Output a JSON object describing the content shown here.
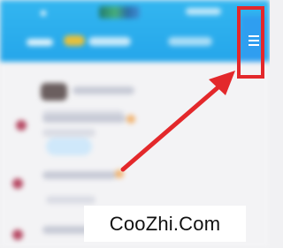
{
  "colors": {
    "header_blue": "#33b6f0",
    "menu_button_blue": "#2f9ef0",
    "highlight_red": "#e3282b",
    "arrow_red": "#e3282b",
    "feed_background": "#f3f3f5"
  },
  "header": {
    "menu_icon": "hamburger-menu-icon"
  },
  "annotation": {
    "highlight": "red-rectangle",
    "arrow": "red-arrow",
    "arrow_direction": "up-right"
  },
  "watermark": {
    "text": "CooZhi.Com"
  }
}
